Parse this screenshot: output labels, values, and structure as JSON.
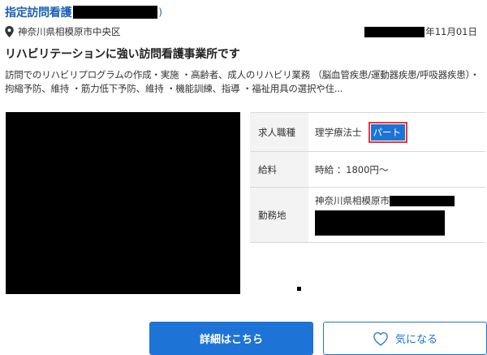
{
  "listing": {
    "title": "指定訪問看護",
    "title_suffix": ")",
    "location": "神奈川県相模原市中央区",
    "date_suffix": "年11月01日",
    "headline": "リハビリテーションに強い訪問看護事業所です",
    "description": "訪問でのリハビリプログラムの作成・実施 ・高齢者、成人のリハビリ業務 （脳血管疾患/運動器疾患/呼吸器疾患）・拘縮予防、維持 ・筋力低下予防、維持 ・機能訓練、指導 ・福祉用具の選択や住..."
  },
  "info": {
    "job_label": "求人職種",
    "job_value": "理学療法士",
    "job_tag": "パート",
    "salary_label": "給料",
    "salary_value": "時給 ：1800円〜",
    "workplace_label": "勤務地",
    "workplace_value": "神奈川県相模原市"
  },
  "buttons": {
    "detail": "詳細はこちら",
    "favorite": "気になる"
  },
  "colors": {
    "link_blue": "#1a5fb4",
    "button_blue": "#1e73d6",
    "highlight_red": "#e53935"
  }
}
